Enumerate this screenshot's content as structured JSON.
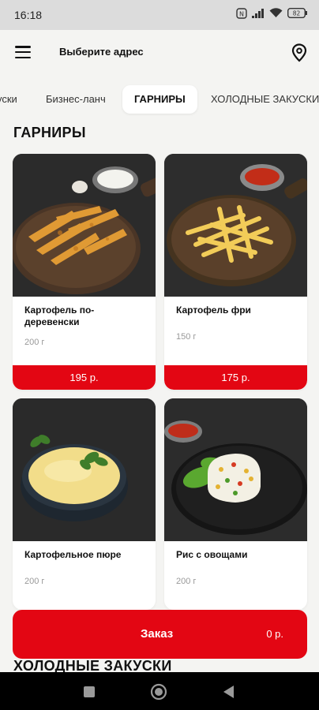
{
  "status_bar": {
    "time": "16:18",
    "icons": [
      "nfc-icon",
      "signal-icon",
      "wifi-icon",
      "battery-icon"
    ],
    "battery_level": "82"
  },
  "header": {
    "address_prompt": "Выберите адрес",
    "menu_icon": "hamburger-menu-icon",
    "location_icon": "map-pin-icon"
  },
  "tabs": [
    {
      "label": "уски"
    },
    {
      "label": "Бизнес-ланч"
    },
    {
      "label": "ГАРНИРЫ",
      "active": true
    },
    {
      "label": "ХОЛОДНЫЕ ЗАКУСКИ"
    }
  ],
  "sections": {
    "current": "ГАРНИРЫ",
    "next": "ХОЛОДНЫЕ ЗАКУСКИ"
  },
  "products": [
    {
      "name": "Картофель по-деревенски",
      "weight": "200 г",
      "price": "195 р."
    },
    {
      "name": "Картофель фри",
      "weight": "150 г",
      "price": "175 р."
    },
    {
      "name": "Картофельное пюре",
      "weight": "200 г",
      "price": ""
    },
    {
      "name": "Рис с овощами",
      "weight": "200 г",
      "price": ""
    }
  ],
  "order": {
    "label": "Заказ",
    "total": "0 р."
  },
  "colors": {
    "accent": "#e30613",
    "background": "#f4f4f2",
    "card": "#ffffff"
  }
}
